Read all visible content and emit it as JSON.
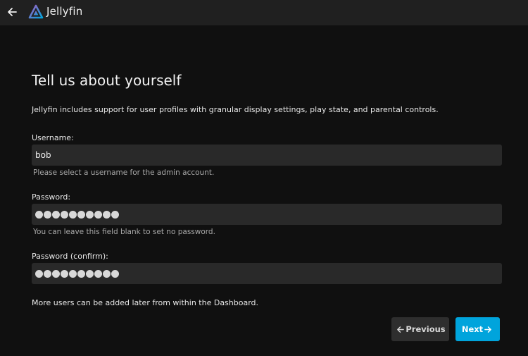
{
  "header": {
    "brand": "Jellyfin",
    "back_icon": "arrow-left-icon",
    "logo_icon": "jellyfin-logo-icon"
  },
  "page": {
    "title": "Tell us about yourself",
    "intro": "Jellyfin includes support for user profiles with granular display settings, play state, and parental controls.",
    "footer_note": "More users can be added later from within the Dashboard."
  },
  "form": {
    "username": {
      "label": "Username:",
      "value": "bob",
      "help": "Please select a username for the admin account."
    },
    "password": {
      "label": "Password:",
      "masked_length": 10,
      "help": "You can leave this field blank to set no password."
    },
    "password_confirm": {
      "label": "Password (confirm):",
      "masked_length": 10
    }
  },
  "buttons": {
    "previous": "Previous",
    "next": "Next"
  },
  "colors": {
    "accent": "#00a4dc",
    "background": "#101010",
    "header": "#202020",
    "input": "#292929"
  }
}
